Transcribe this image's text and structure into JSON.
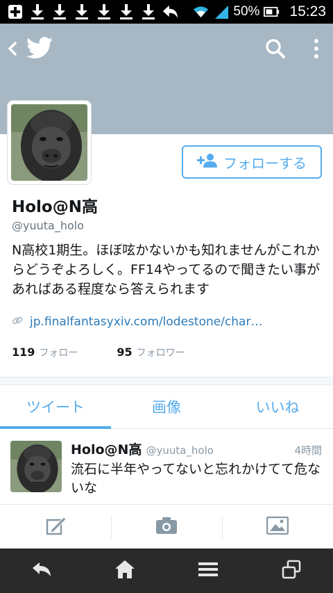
{
  "statusbar": {
    "battery": "50%",
    "time": "15:23",
    "icons": [
      "add-icon",
      "download-icon",
      "download-icon",
      "download-icon",
      "download-icon",
      "download-icon",
      "download-icon",
      "reply-icon",
      "wifi-icon",
      "signal-icon",
      "battery-icon"
    ]
  },
  "header": {
    "back_icon": "chevron-left-icon",
    "logo_icon": "twitter-bird-icon",
    "search_icon": "search-icon",
    "more_icon": "more-vertical-icon"
  },
  "profile": {
    "name": "Holo@N高",
    "handle": "@yuuta_holo",
    "bio": "N高校1期生。ほぼ呟かないかも知れませんがこれからどうぞよろしく。FF14やってるので聞きたい事があればある程度なら答えられます",
    "link": "jp.finalfantasyxiv.com/lodestone/char…",
    "following_count": "119",
    "following_label": "フォロー",
    "followers_count": "95",
    "followers_label": "フォロワー",
    "follow_button": "フォローする"
  },
  "tabs": [
    {
      "label": "ツイート",
      "active": true
    },
    {
      "label": "画像",
      "active": false
    },
    {
      "label": "いいね",
      "active": false
    }
  ],
  "tweet": {
    "name": "Holo@N高",
    "handle": "@yuuta_holo",
    "time": "4時間",
    "text": "流石に半年やってないと忘れかけてて危ないな"
  },
  "compose": {
    "icons": [
      "compose-icon",
      "camera-icon",
      "image-icon"
    ]
  },
  "navbar": {
    "icons": [
      "back-icon",
      "home-icon",
      "menu-icon",
      "recent-apps-icon"
    ]
  },
  "colors": {
    "accent": "#55acee",
    "banner": "#a7b7c4",
    "link": "#2b7bb9"
  }
}
